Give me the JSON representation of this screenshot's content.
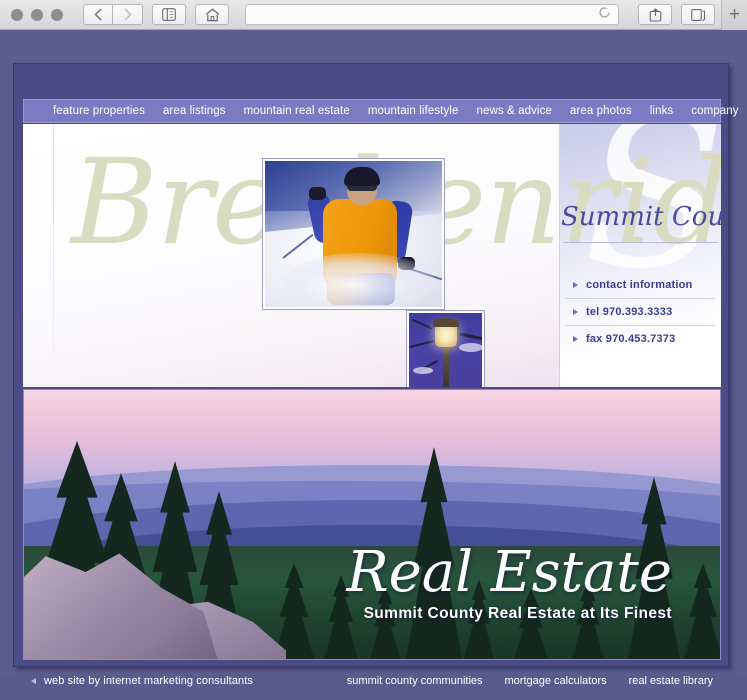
{
  "browser": {
    "address_value": "",
    "address_placeholder": "",
    "back_label": "‹",
    "forward_label": "›",
    "sidebar_icon": "sidebar-icon",
    "home_icon": "home-icon",
    "reload_icon": "reload-icon",
    "share_icon": "share-icon",
    "newtab_icon": "new-tab-icon",
    "plus_label": "+"
  },
  "site": {
    "nav": [
      {
        "label": "feature properties"
      },
      {
        "label": "area listings"
      },
      {
        "label": "mountain real estate"
      },
      {
        "label": "mountain lifestyle"
      },
      {
        "label": "news & advice"
      },
      {
        "label": "area photos"
      },
      {
        "label": "links"
      },
      {
        "label": "company"
      }
    ],
    "header": {
      "wordmark": "Breckenridge",
      "watermark": "S",
      "region_script": "Summit County"
    },
    "contact": [
      {
        "label": "contact information"
      },
      {
        "label": "tel  970.393.3333"
      },
      {
        "label": "fax 970.453.7373"
      }
    ],
    "hero": {
      "script_title": "Real Estate",
      "tagline": "Summit County Real Estate at Its Finest"
    },
    "footer": {
      "credit": "web site by internet marketing consultants",
      "links": [
        {
          "label": "summit county communities"
        },
        {
          "label": "mortgage calculators"
        },
        {
          "label": "real estate library"
        }
      ]
    }
  },
  "colors": {
    "frame_purple": "#4b4b86",
    "backdrop_purple": "#5c5c90",
    "nav_purple": "#7b7bc4",
    "script_olive": "#d9dcc0",
    "contact_blue": "#3c3c96"
  }
}
